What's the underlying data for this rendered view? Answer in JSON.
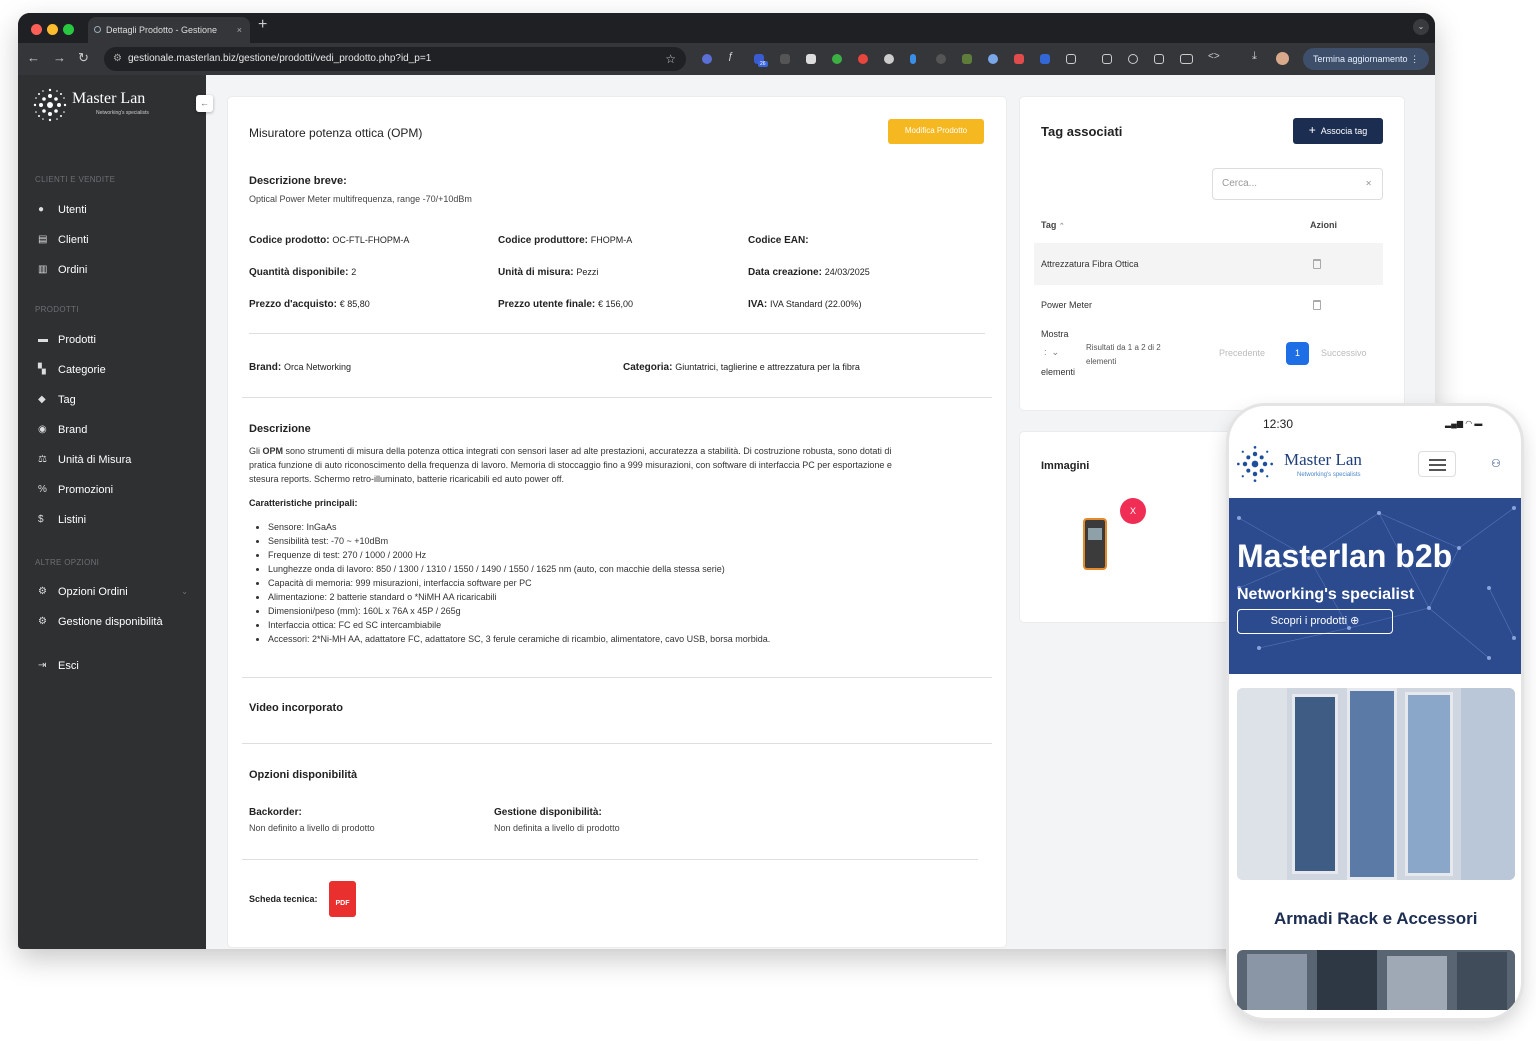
{
  "browser": {
    "tab_title": "Dettagli Prodotto - Gestione",
    "tab_close": "×",
    "new_tab": "+",
    "url": "gestionale.masterlan.biz/gestione/prodotti/vedi_prodotto.php?id_p=1",
    "update_button": "Termina aggiornamento",
    "extension_badge": "26"
  },
  "sidebar": {
    "logo_text": "Master Lan",
    "logo_tagline": "Networking's specialists",
    "section_clients": "CLIENTI E VENDITE",
    "section_products": "PRODOTTI",
    "section_other": "ALTRE OPZIONI",
    "items": [
      {
        "label": "Utenti",
        "icon": "user-icon"
      },
      {
        "label": "Clienti",
        "icon": "contacts-icon"
      },
      {
        "label": "Ordini",
        "icon": "cart-icon"
      },
      {
        "label": "Prodotti",
        "icon": "box-icon"
      },
      {
        "label": "Categorie",
        "icon": "grid-icon"
      },
      {
        "label": "Tag",
        "icon": "tag-icon"
      },
      {
        "label": "Brand",
        "icon": "brand-icon"
      },
      {
        "label": "Unità di Misura",
        "icon": "scale-icon"
      },
      {
        "label": "Promozioni",
        "icon": "percent-icon"
      },
      {
        "label": "Listini",
        "icon": "price-icon"
      },
      {
        "label": "Opzioni Ordini",
        "icon": "gear-icon"
      },
      {
        "label": "Gestione disponibilità",
        "icon": "gear-icon"
      },
      {
        "label": "Esci",
        "icon": "logout-icon"
      }
    ]
  },
  "product": {
    "title": "Misuratore potenza ottica (OPM)",
    "edit_button": "Modifica Prodotto",
    "short_desc_label": "Descrizione breve:",
    "short_desc": "Optical Power Meter multifrequenza, range -70/+10dBm",
    "codice_prodotto_label": "Codice prodotto:",
    "codice_prodotto": "OC-FTL-FHOPM-A",
    "codice_produttore_label": "Codice produttore:",
    "codice_produttore": "FHOPM-A",
    "codice_ean_label": "Codice EAN:",
    "quantita_label": "Quantità disponibile:",
    "quantita": "2",
    "unita_label": "Unità di misura:",
    "unita": "Pezzi",
    "data_label": "Data creazione:",
    "data": "24/03/2025",
    "prezzo_acquisto_label": "Prezzo d'acquisto:",
    "prezzo_acquisto": "€ 85,80",
    "prezzo_finale_label": "Prezzo utente finale:",
    "prezzo_finale": "€ 156,00",
    "iva_label": "IVA:",
    "iva": "IVA Standard (22.00%)",
    "brand_label": "Brand:",
    "brand": "Orca Networking",
    "categoria_label": "Categoria:",
    "categoria": "Giuntatrici, taglierine e attrezzatura per la fibra",
    "descrizione_heading": "Descrizione",
    "desc_line1_prefix": "Gli ",
    "desc_line1_bold": "OPM",
    "desc_line1_rest": " sono strumenti di misura della potenza ottica integrati con sensori laser ad alte prestazioni, accuratezza a stabilità. Di costruzione robusta, sono dotati di",
    "desc_line2": "pratica funzione di auto riconoscimento della frequenza di lavoro. Memoria di stoccaggio fino a 999 misurazioni, con software di interfaccia PC per esportazione e",
    "desc_line3": "stesura reports. Schermo retro-illuminato, batterie ricaricabili ed auto power off.",
    "features_heading": "Caratteristiche principali:",
    "features": [
      "Sensore: InGaAs",
      "Sensibilità test: -70 ~ +10dBm",
      "Frequenze di test: 270 / 1000 / 2000 Hz",
      "Lunghezze onda di lavoro: 850 / 1300 / 1310 / 1550 / 1490 / 1550 / 1625 nm (auto, con macchie della stessa serie)",
      "Capacità di memoria: 999 misurazioni, interfaccia software per PC",
      "Alimentazione: 2 batterie standard o *NiMH AA ricaricabili",
      "Dimensioni/peso (mm): 160L x 76A x 45P / 265g",
      "Interfaccia ottica: FC ed SC intercambiabile",
      "Accessori: 2*Ni-MH AA, adattatore FC, adattatore SC, 3 ferule ceramiche di ricambio, alimentatore, cavo USB, borsa morbida."
    ],
    "video_heading": "Video incorporato",
    "availability_heading": "Opzioni disponibilità",
    "backorder_label": "Backorder:",
    "backorder_value": "Non definito a livello di prodotto",
    "gestione_label": "Gestione disponibilità:",
    "gestione_value": "Non definita a livello di prodotto",
    "scheda_label": "Scheda tecnica:",
    "pdf_label": "PDF"
  },
  "tags": {
    "heading": "Tag associati",
    "add_button": "Associa tag",
    "search_placeholder": "Cerca...",
    "col_tag": "Tag",
    "col_actions": "Azioni",
    "rows": [
      "Attrezzatura Fibra Ottica",
      "Power Meter"
    ],
    "mostra": "Mostra",
    "elementi": "elementi",
    "select_value": ":",
    "results_line1": "Risultati da 1 a 2 di 2",
    "results_line2": "elementi",
    "prev": "Precedente",
    "page": "1",
    "next": "Successivo"
  },
  "images": {
    "heading": "Immagini",
    "remove": "X"
  },
  "phone": {
    "time": "12:30",
    "logo_text": "Master Lan",
    "logo_tagline": "Networking's specialists",
    "hero_title": "Masterlan b2b",
    "hero_subtitle": "Networking's specialist",
    "hero_button": "Scopri i prodotti ⊕",
    "section_title": "Armadi Rack e Accessori"
  },
  "colors": {
    "sidebar": "#2f3032",
    "accent_yellow": "#f5b820",
    "navy": "#1c2d52",
    "pagination_blue": "#1e6fe6",
    "remove_red": "#ef2d55",
    "hero_blue": "#2c4b8f"
  }
}
